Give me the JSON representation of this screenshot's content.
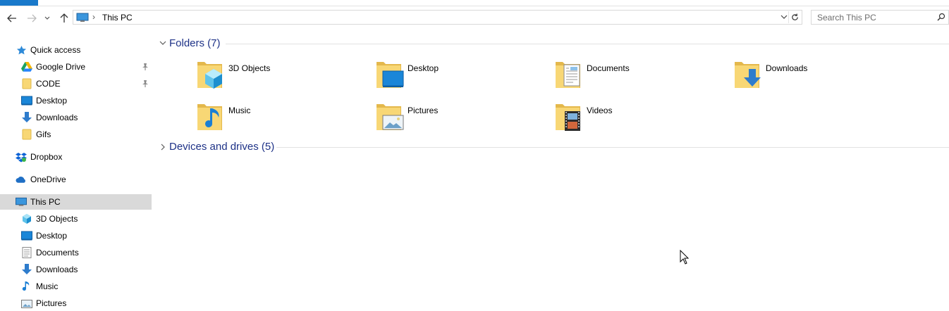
{
  "window": {
    "accent": "#1979ca"
  },
  "address_bar": {
    "crumb": "This PC",
    "separator": "›"
  },
  "search": {
    "placeholder": "Search This PC"
  },
  "sidebar": {
    "items": [
      {
        "label": "Quick access",
        "icon": "star-icon"
      },
      {
        "label": "Google Drive",
        "icon": "google-drive-icon",
        "pinned": true
      },
      {
        "label": "CODE",
        "icon": "folder-icon",
        "pinned": true
      },
      {
        "label": "Desktop",
        "icon": "desktop-icon"
      },
      {
        "label": "Downloads",
        "icon": "downloads-icon"
      },
      {
        "label": "Gifs",
        "icon": "folder-icon"
      },
      {
        "label": "Dropbox",
        "icon": "dropbox-icon"
      },
      {
        "label": "OneDrive",
        "icon": "onedrive-icon"
      },
      {
        "label": "This PC",
        "icon": "computer-icon",
        "selected": true
      },
      {
        "label": "3D Objects",
        "icon": "3d-objects-icon"
      },
      {
        "label": "Desktop",
        "icon": "desktop-icon"
      },
      {
        "label": "Documents",
        "icon": "documents-icon"
      },
      {
        "label": "Downloads",
        "icon": "downloads-icon"
      },
      {
        "label": "Music",
        "icon": "music-icon"
      },
      {
        "label": "Pictures",
        "icon": "pictures-icon"
      }
    ]
  },
  "content": {
    "folders_header": "Folders (7)",
    "devices_header": "Devices and drives (5)",
    "folders": [
      {
        "label": "3D Objects",
        "icon": "3d-objects-folder-icon"
      },
      {
        "label": "Desktop",
        "icon": "desktop-folder-icon"
      },
      {
        "label": "Documents",
        "icon": "documents-folder-icon"
      },
      {
        "label": "Downloads",
        "icon": "downloads-folder-icon"
      },
      {
        "label": "Music",
        "icon": "music-folder-icon"
      },
      {
        "label": "Pictures",
        "icon": "pictures-folder-icon"
      },
      {
        "label": "Videos",
        "icon": "videos-folder-icon"
      }
    ]
  }
}
